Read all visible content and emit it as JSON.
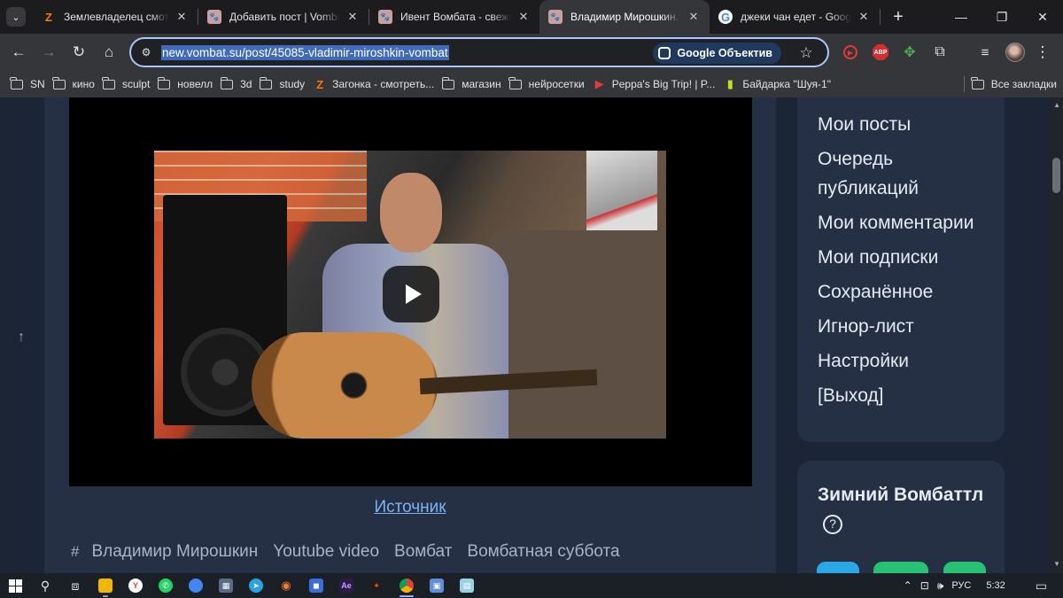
{
  "tabs": [
    {
      "title": "Землевладелец смотреть",
      "favicon": "Z",
      "favicon_color": "#f57c00"
    },
    {
      "title": "Добавить пост | Vombat",
      "favicon": "wombat-icon",
      "favicon_color": "#c9a0a0"
    },
    {
      "title": "Ивент Вомбата - свежие",
      "favicon": "wombat-icon",
      "favicon_color": "#c9a0a0"
    },
    {
      "title": "Владимир Мирошкин. В",
      "favicon": "wombat-icon",
      "favicon_color": "#c9a0a0",
      "active": true
    },
    {
      "title": "джеки чан едет - Google",
      "favicon": "G",
      "favicon_color": "#4285f4"
    }
  ],
  "tab_close_glyph": "✕",
  "new_tab_glyph": "+",
  "address_bar": {
    "url": "new.vombat.su/post/45085-vladimir-miroshkin-vombat",
    "lens_label": "Google Объектив"
  },
  "bookmarks": [
    {
      "label": "SN",
      "type": "folder"
    },
    {
      "label": "кино",
      "type": "folder"
    },
    {
      "label": "sculpt",
      "type": "folder"
    },
    {
      "label": "новелл",
      "type": "folder"
    },
    {
      "label": "3d",
      "type": "folder"
    },
    {
      "label": "study",
      "type": "folder"
    },
    {
      "label": "Загонка - смотреть...",
      "type": "link",
      "icon": "Z",
      "icon_color": "#f57c00"
    },
    {
      "label": "магазин",
      "type": "folder"
    },
    {
      "label": "нейросетки",
      "type": "folder"
    },
    {
      "label": "Peppa's Big Trip! | P...",
      "type": "link",
      "icon": "▶",
      "icon_color": "#e53935"
    },
    {
      "label": "Байдарка \"Шуя-1\"",
      "type": "link",
      "icon": "▮",
      "icon_color": "#c6d82a"
    }
  ],
  "all_bookmarks_label": "Все закладки",
  "post": {
    "source_link": "Источник",
    "tag_hash": "#",
    "tags": [
      "Владимир Мирошкин",
      "Youtube video",
      "Вомбат",
      "Вомбатная суббота"
    ]
  },
  "sidebar_menu": [
    "Мои посты",
    "Очередь публикаций",
    "Мои комментарии",
    "Мои подписки",
    "Сохранённое",
    "Игнор-лист",
    "Настройки",
    "[Выход]"
  ],
  "widget": {
    "title": "Зимний Вомбаттл",
    "help_glyph": "?"
  },
  "taskbar": {
    "lang": "РУС",
    "time": "5:32"
  },
  "colors": {
    "accent": "#a8c7fa",
    "link": "#7ab3f0",
    "page_bg": "#1c2535",
    "card_bg": "#253044"
  }
}
